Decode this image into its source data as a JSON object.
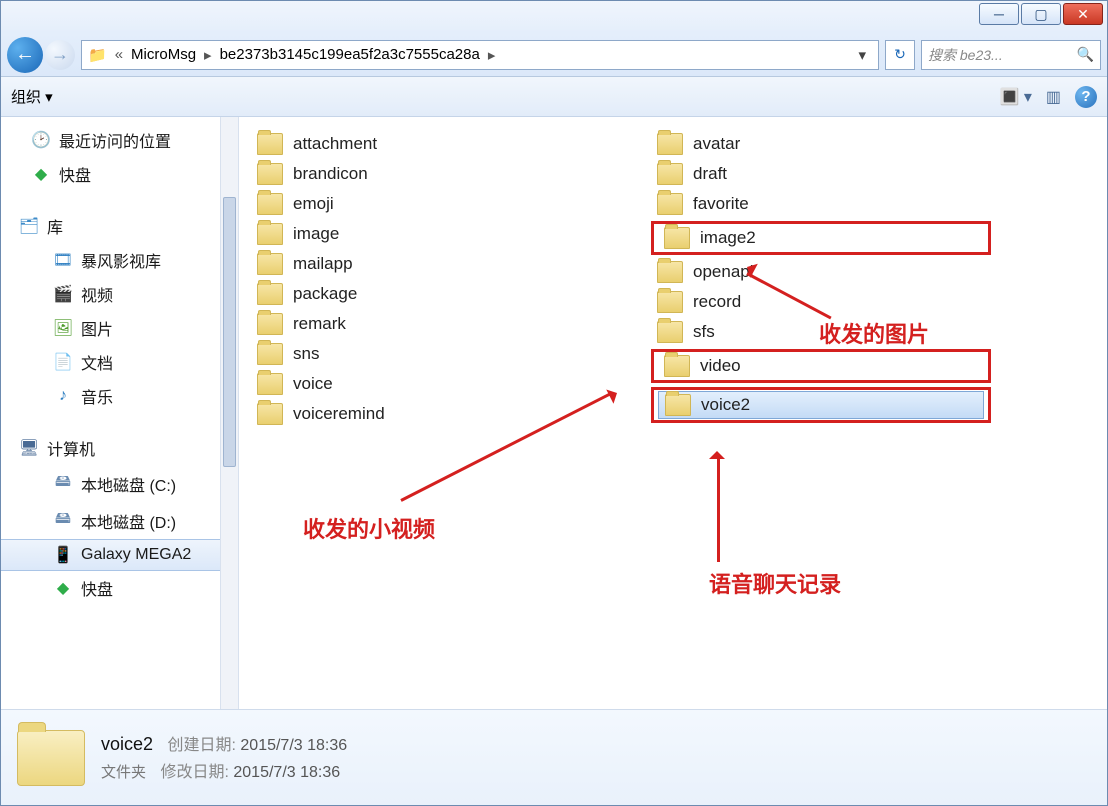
{
  "breadcrumb": {
    "prefix": "«",
    "part1": "MicroMsg",
    "part2": "be2373b3145c199ea5f2a3c7555ca28a"
  },
  "search": {
    "placeholder": "搜索 be23..."
  },
  "toolbar": {
    "organize": "组织 ▾"
  },
  "sidebar": {
    "recent": "最近访问的位置",
    "kuaipan": "快盘",
    "libraries": "库",
    "baofeng": "暴风影视库",
    "videos": "视频",
    "pictures": "图片",
    "docs": "文档",
    "music": "音乐",
    "computer": "计算机",
    "driveC": "本地磁盘 (C:)",
    "driveD": "本地磁盘 (D:)",
    "galaxy": "Galaxy MEGA2",
    "kuaipan2": "快盘"
  },
  "folders_col1": [
    "attachment",
    "brandicon",
    "emoji",
    "image",
    "mailapp",
    "package",
    "remark",
    "sns",
    "voice",
    "voiceremind"
  ],
  "folders_col2": [
    "avatar",
    "draft",
    "favorite",
    "image2",
    "openapi",
    "record",
    "sfs",
    "video",
    "voice2"
  ],
  "highlighted": [
    "image2",
    "video",
    "voice2"
  ],
  "selected_folder": "voice2",
  "annotations": {
    "images": "收发的图片",
    "smallvideo": "收发的小视频",
    "voicechat": "语音聊天记录"
  },
  "details": {
    "name": "voice2",
    "type": "文件夹",
    "created_label": "创建日期:",
    "created_value": "2015/7/3 18:36",
    "modified_label": "修改日期:",
    "modified_value": "2015/7/3 18:36"
  }
}
